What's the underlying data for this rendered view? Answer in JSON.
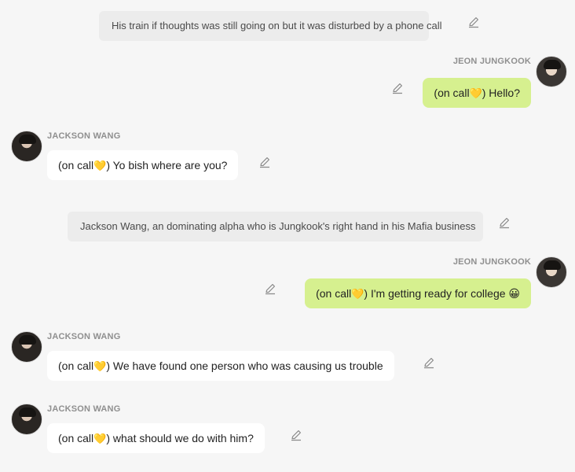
{
  "messages": [
    {
      "type": "narration",
      "text": "His train if thoughts was still going on but it was disturbed by a phone call"
    },
    {
      "type": "message",
      "side": "right",
      "sender": "JEON JUNGKOOK",
      "prefix": "(on call",
      "heart": "💛",
      "text": ") Hello?"
    },
    {
      "type": "message",
      "side": "left",
      "sender": "JACKSON WANG",
      "prefix": "(on call",
      "heart": "💛",
      "text": ") Yo bish where are you?"
    },
    {
      "type": "narration",
      "text": "Jackson Wang, an dominating alpha who is Jungkook's right hand in his Mafia business"
    },
    {
      "type": "message",
      "side": "right",
      "sender": "JEON JUNGKOOK",
      "prefix": "(on call",
      "heart": "💛",
      "text": ") I'm getting ready for college 😀"
    },
    {
      "type": "message",
      "side": "left",
      "sender": "JACKSON WANG",
      "prefix": "(on call",
      "heart": "💛",
      "text": ") We have found one person who was causing us trouble"
    },
    {
      "type": "message",
      "side": "left",
      "sender": "JACKSON WANG",
      "prefix": "(on call",
      "heart": "💛",
      "text": ") what should we do with him?"
    }
  ],
  "colors": {
    "background": "#f6f6f6",
    "narration_bg": "#ececec",
    "bubble_left": "#ffffff",
    "bubble_right": "#d6f08f"
  },
  "icons": {
    "edit": "edit-pencil-icon"
  }
}
